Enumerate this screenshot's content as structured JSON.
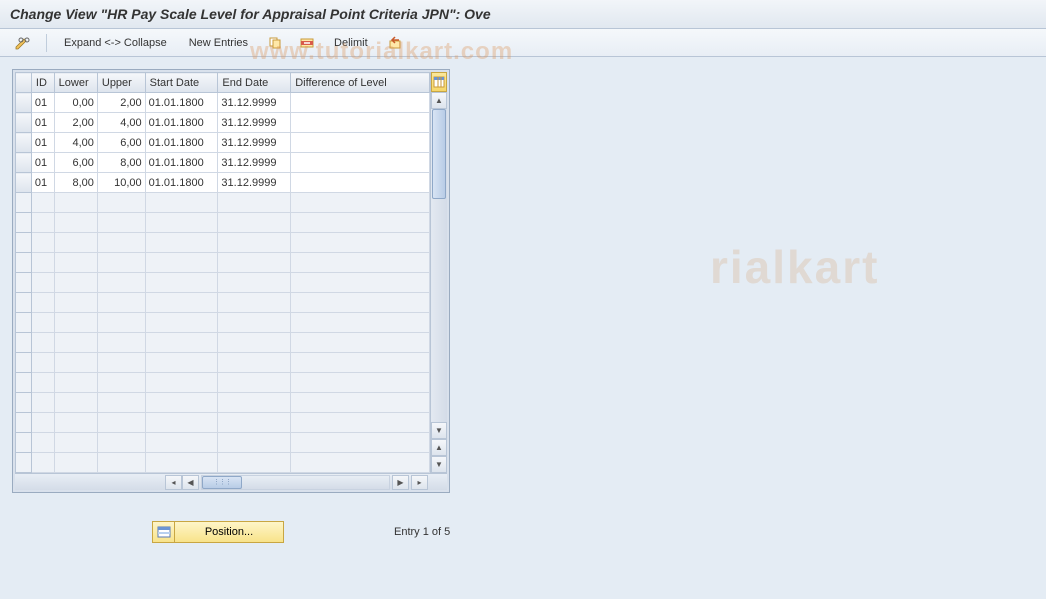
{
  "title": "Change View \"HR Pay Scale Level for Appraisal Point Criteria JPN\": Ove",
  "toolbar": {
    "expand_collapse": "Expand <-> Collapse",
    "new_entries": "New Entries",
    "delimit": "Delimit"
  },
  "icons": {
    "pencil": "pencil-glasses-icon",
    "copy": "copy-icon",
    "delete": "delete-row-icon",
    "undo": "undo-icon",
    "config": "table-settings-icon",
    "position": "position-icon"
  },
  "table": {
    "headers": {
      "id": "ID",
      "lower": "Lower",
      "upper": "Upper",
      "start": "Start Date",
      "end": "End Date",
      "diff": "Difference of Level"
    },
    "rows": [
      {
        "id": "01",
        "lower": "0,00",
        "upper": "2,00",
        "start": "01.01.1800",
        "end": "31.12.9999",
        "diff": ""
      },
      {
        "id": "01",
        "lower": "2,00",
        "upper": "4,00",
        "start": "01.01.1800",
        "end": "31.12.9999",
        "diff": ""
      },
      {
        "id": "01",
        "lower": "4,00",
        "upper": "6,00",
        "start": "01.01.1800",
        "end": "31.12.9999",
        "diff": ""
      },
      {
        "id": "01",
        "lower": "6,00",
        "upper": "8,00",
        "start": "01.01.1800",
        "end": "31.12.9999",
        "diff": ""
      },
      {
        "id": "01",
        "lower": "8,00",
        "upper": "10,00",
        "start": "01.01.1800",
        "end": "31.12.9999",
        "diff": ""
      }
    ],
    "empty_row_count": 14
  },
  "footer": {
    "position_label": "Position...",
    "entry_text": "Entry 1 of 5"
  }
}
